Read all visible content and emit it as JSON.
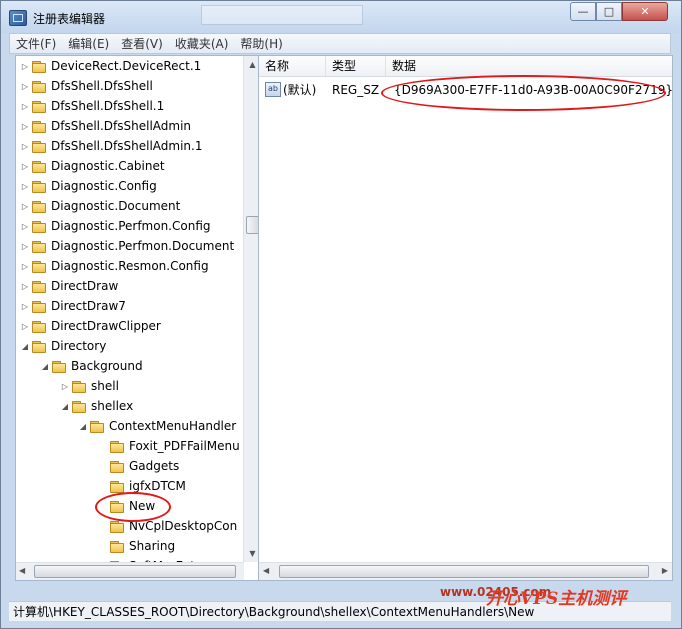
{
  "window": {
    "title": "注册表编辑器",
    "ghost_title": ""
  },
  "menu": [
    "文件(F)",
    "编辑(E)",
    "查看(V)",
    "收藏夹(A)",
    "帮助(H)"
  ],
  "controls": {
    "minimize": "—",
    "maximize": "□",
    "close": "✕"
  },
  "tree": [
    {
      "label": "DeviceRect.DeviceRect.1",
      "depth": 0,
      "expander": "▷"
    },
    {
      "label": "DfsShell.DfsShell",
      "depth": 0,
      "expander": "▷"
    },
    {
      "label": "DfsShell.DfsShell.1",
      "depth": 0,
      "expander": "▷"
    },
    {
      "label": "DfsShell.DfsShellAdmin",
      "depth": 0,
      "expander": "▷"
    },
    {
      "label": "DfsShell.DfsShellAdmin.1",
      "depth": 0,
      "expander": "▷"
    },
    {
      "label": "Diagnostic.Cabinet",
      "depth": 0,
      "expander": "▷"
    },
    {
      "label": "Diagnostic.Config",
      "depth": 0,
      "expander": "▷"
    },
    {
      "label": "Diagnostic.Document",
      "depth": 0,
      "expander": "▷"
    },
    {
      "label": "Diagnostic.Perfmon.Config",
      "depth": 0,
      "expander": "▷"
    },
    {
      "label": "Diagnostic.Perfmon.Document",
      "depth": 0,
      "expander": "▷"
    },
    {
      "label": "Diagnostic.Resmon.Config",
      "depth": 0,
      "expander": "▷"
    },
    {
      "label": "DirectDraw",
      "depth": 0,
      "expander": "▷"
    },
    {
      "label": "DirectDraw7",
      "depth": 0,
      "expander": "▷"
    },
    {
      "label": "DirectDrawClipper",
      "depth": 0,
      "expander": "▷"
    },
    {
      "label": "Directory",
      "depth": 0,
      "expander": "◢"
    },
    {
      "label": "Background",
      "depth": 1,
      "expander": "◢"
    },
    {
      "label": "shell",
      "depth": 2,
      "expander": "▷"
    },
    {
      "label": "shellex",
      "depth": 2,
      "expander": "◢"
    },
    {
      "label": "ContextMenuHandler",
      "depth": 3,
      "expander": "◢"
    },
    {
      "label": "Foxit_PDFFailMenu",
      "depth": 4,
      "expander": ""
    },
    {
      "label": "Gadgets",
      "depth": 4,
      "expander": ""
    },
    {
      "label": "igfxDTCM",
      "depth": 4,
      "expander": ""
    },
    {
      "label": "New",
      "depth": 4,
      "expander": ""
    },
    {
      "label": "NvCplDesktopCon",
      "depth": 4,
      "expander": ""
    },
    {
      "label": "Sharing",
      "depth": 4,
      "expander": ""
    },
    {
      "label": "SoftMgrExt",
      "depth": 4,
      "expander": ""
    }
  ],
  "values": {
    "headers": {
      "name": "名称",
      "type": "类型",
      "data": "数据"
    },
    "rows": [
      {
        "icon": "ab",
        "name": "(默认)",
        "type": "REG_SZ",
        "data": "{D969A300-E7FF-11d0-A93B-00A0C90F2719}"
      }
    ]
  },
  "status": "计算机\\HKEY_CLASSES_ROOT\\Directory\\Background\\shellex\\ContextMenuHandlers\\New",
  "watermark": {
    "url": "www.02405.com",
    "text": "开心VPS主机测评"
  },
  "colors": {
    "annotation": "#e01818",
    "titlebar": "#c8d9ee"
  }
}
